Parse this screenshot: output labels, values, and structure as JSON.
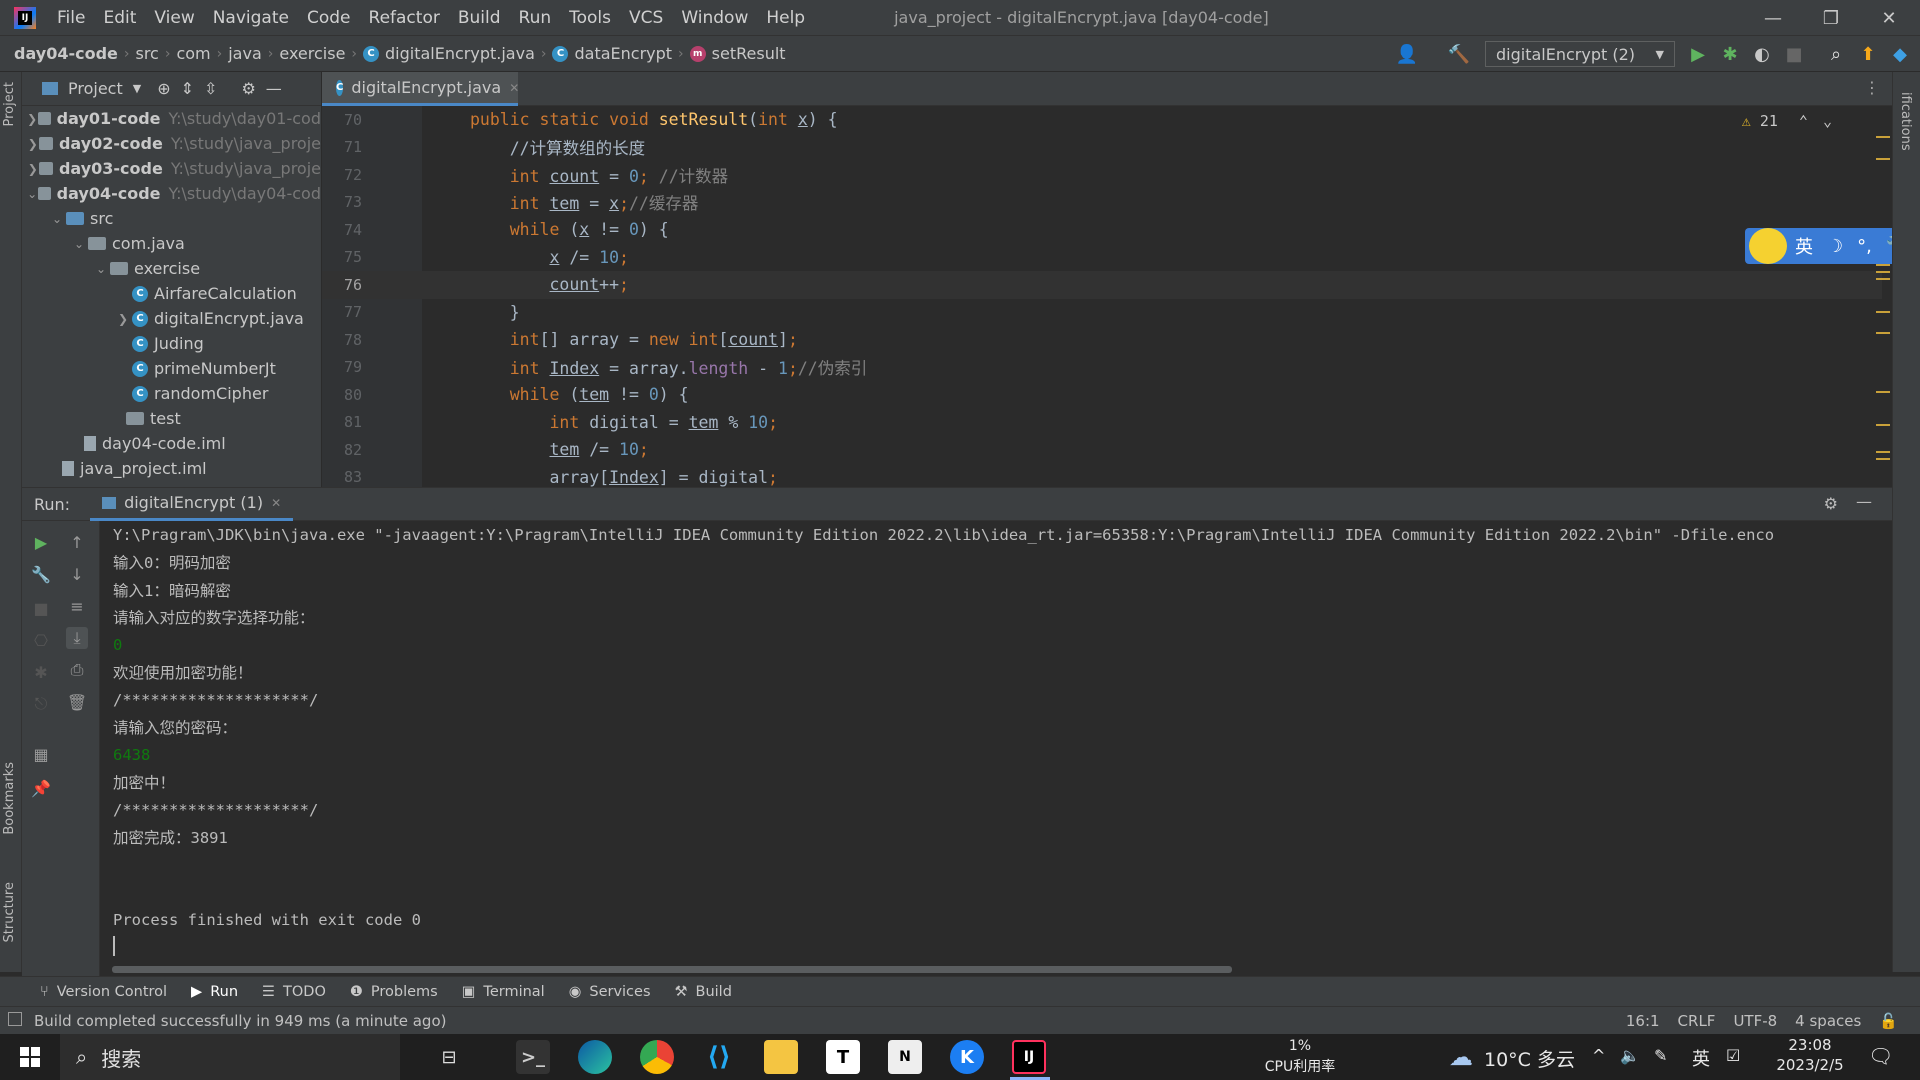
{
  "window": {
    "title": "java_project - digitalEncrypt.java [day04-code]",
    "menu": [
      "File",
      "Edit",
      "View",
      "Navigate",
      "Code",
      "Refactor",
      "Build",
      "Run",
      "Tools",
      "VCS",
      "Window",
      "Help"
    ],
    "controls": {
      "minimize": "—",
      "restore": "❐",
      "close": "✕"
    }
  },
  "breadcrumb": [
    "day04-code",
    "src",
    "com",
    "java",
    "exercise",
    "digitalEncrypt.java",
    "dataEncrypt",
    "setResult"
  ],
  "run_config": {
    "label": "digitalEncrypt (2)"
  },
  "project_panel": {
    "header": "Project",
    "tree": [
      {
        "name": "day01-code",
        "path": "Y:\\study\\day01-cod"
      },
      {
        "name": "day02-code",
        "path": "Y:\\study\\java_proje"
      },
      {
        "name": "day03-code",
        "path": "Y:\\study\\java_proje"
      },
      {
        "name": "day04-code",
        "path": "Y:\\study\\day04-cod"
      },
      {
        "name": "src"
      },
      {
        "name": "com.java"
      },
      {
        "name": "exercise"
      },
      {
        "name": "AirfareCalculation"
      },
      {
        "name": "digitalEncrypt.java"
      },
      {
        "name": "Juding"
      },
      {
        "name": "primeNumberJt"
      },
      {
        "name": "randomCipher"
      },
      {
        "name": "test"
      },
      {
        "name": "day04-code.iml"
      },
      {
        "name": "java_project.iml"
      }
    ]
  },
  "editor": {
    "tab": "digitalEncrypt.java",
    "warnings": "21",
    "lines": [
      {
        "n": "70",
        "text": "public static void setResult(int x) {"
      },
      {
        "n": "71",
        "text": "    //计算数组的长度"
      },
      {
        "n": "72",
        "text": "    int count = 0; //计数器"
      },
      {
        "n": "73",
        "text": "    int tem = x;//缓存器"
      },
      {
        "n": "74",
        "text": "    while (x != 0) {"
      },
      {
        "n": "75",
        "text": "        x /= 10;"
      },
      {
        "n": "76",
        "text": "        count++;"
      },
      {
        "n": "77",
        "text": "    }"
      },
      {
        "n": "78",
        "text": "    int[] array = new int[count];"
      },
      {
        "n": "79",
        "text": "    int Index = array.length - 1;//伪索引"
      },
      {
        "n": "80",
        "text": "    while (tem != 0) {"
      },
      {
        "n": "81",
        "text": "        int digital = tem % 10;"
      },
      {
        "n": "82",
        "text": "        tem /= 10;"
      },
      {
        "n": "83",
        "text": "        array[Index] = digital;"
      }
    ]
  },
  "ime_bar": {
    "lang": "英",
    "moon": "☽",
    "punct": "°,",
    "tool": "🔧"
  },
  "run_panel": {
    "label": "Run:",
    "tab": "digitalEncrypt (1)",
    "console": [
      {
        "text": "Y:\\Pragram\\JDK\\bin\\java.exe \"-javaagent:Y:\\Pragram\\IntelliJ IDEA Community Edition 2022.2\\lib\\idea_rt.jar=65358:Y:\\Pragram\\IntelliJ IDEA Community Edition 2022.2\\bin\" -Dfile.enco",
        "input": false
      },
      {
        "text": "输入0：明码加密",
        "input": false
      },
      {
        "text": "输入1：暗码解密",
        "input": false
      },
      {
        "text": "请输入对应的数字选择功能：",
        "input": false
      },
      {
        "text": "0",
        "input": true
      },
      {
        "text": "欢迎使用加密功能！",
        "input": false
      },
      {
        "text": "/********************/",
        "input": false
      },
      {
        "text": "请输入您的密码：",
        "input": false
      },
      {
        "text": "6438",
        "input": true
      },
      {
        "text": "加密中！",
        "input": false
      },
      {
        "text": "/********************/",
        "input": false
      },
      {
        "text": "加密完成：3891",
        "input": false
      },
      {
        "text": "",
        "input": false
      },
      {
        "text": "",
        "input": false
      },
      {
        "text": "Process finished with exit code 0",
        "input": false
      }
    ]
  },
  "side_labels": {
    "project": "Project",
    "bookmarks": "Bookmarks",
    "structure": "Structure",
    "notifications": "ifications"
  },
  "bottom_tools": [
    "Version Control",
    "Run",
    "TODO",
    "Problems",
    "Terminal",
    "Services",
    "Build"
  ],
  "status": {
    "message": "Build completed successfully in 949 ms (a minute ago)",
    "position": "16:1",
    "line_sep": "CRLF",
    "encoding": "UTF-8",
    "indent": "4 spaces"
  },
  "taskbar": {
    "search": "搜索",
    "cpu_percent": "1%",
    "cpu_label": "CPU利用率",
    "weather": "10°C 多云",
    "ime": "英",
    "time": "23:08",
    "date": "2023/2/5"
  },
  "colors": {
    "accent": "#4a88c7",
    "console_input": "#0f7a0f",
    "keyword": "#cc7832",
    "number": "#6897bb",
    "comment": "#808080"
  }
}
